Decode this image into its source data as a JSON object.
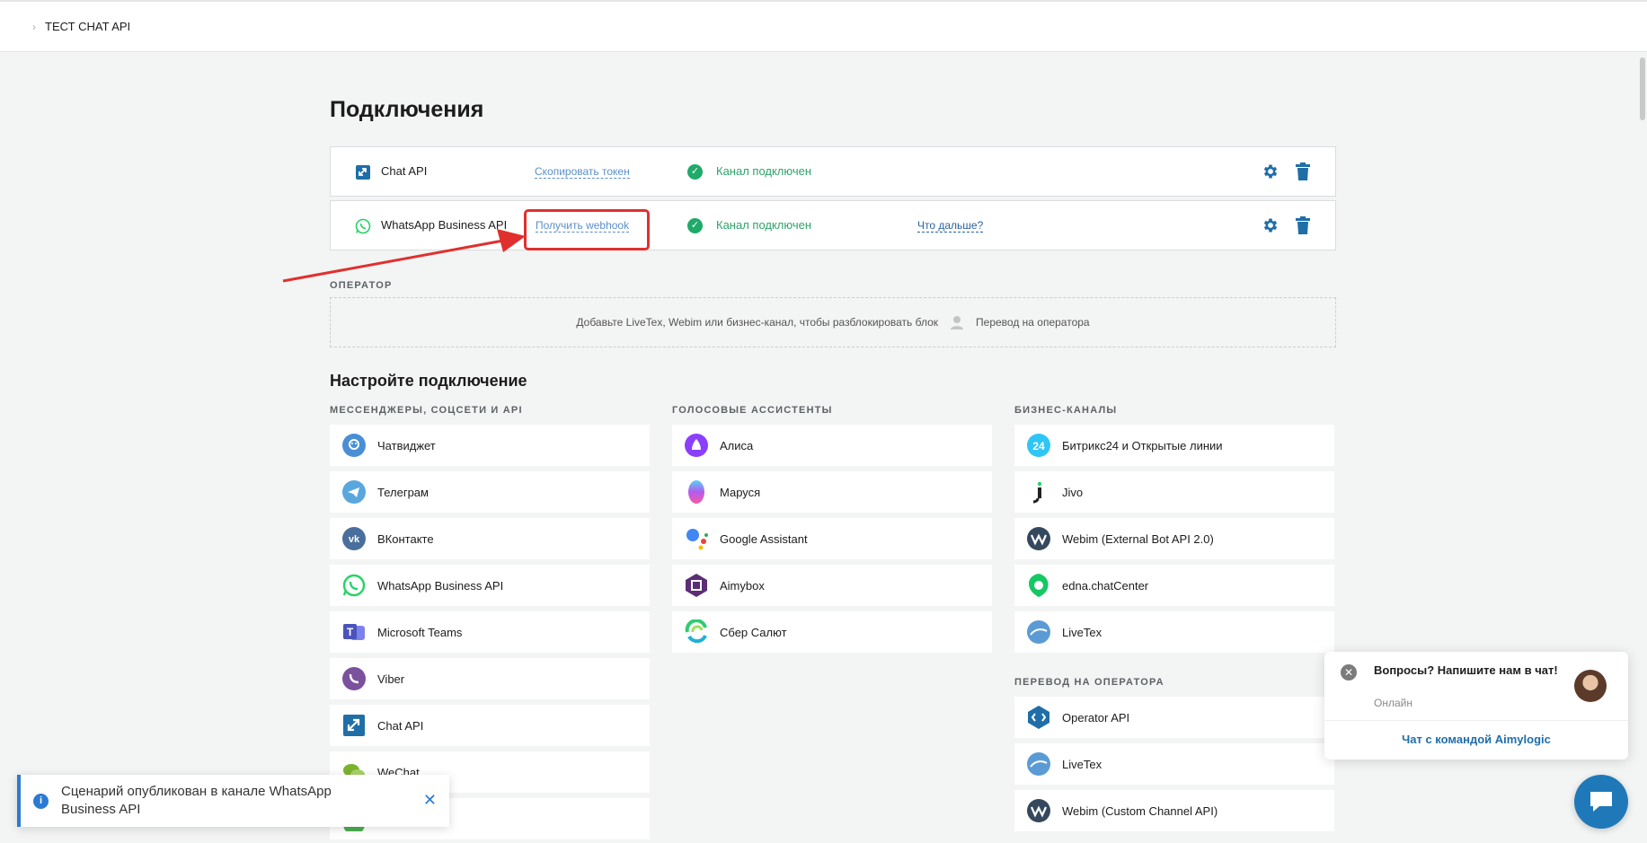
{
  "breadcrumb": {
    "item": "ТЕСТ CHAT API"
  },
  "page": {
    "title": "Подключения"
  },
  "connections": [
    {
      "name": "Chat API",
      "action": "Скопировать токен",
      "status": "Канал подключен",
      "next": ""
    },
    {
      "name": "WhatsApp Business API",
      "action": "Получить webhook",
      "status": "Канал подключен",
      "next": "Что дальше?"
    }
  ],
  "operator": {
    "label": "ОПЕРАТОР",
    "message": "Добавьте LiveTex, Webim или бизнес-канал, чтобы разблокировать блок",
    "action": "Перевод на оператора"
  },
  "setup": {
    "title": "Настройте подключение",
    "messengers": {
      "label": "МЕССЕНДЖЕРЫ, СОЦСЕТИ И API",
      "items": [
        "Чатвиджет",
        "Телеграм",
        "ВКонтакте",
        "WhatsApp Business API",
        "Microsoft Teams",
        "Viber",
        "Chat API",
        "WeChat",
        ""
      ]
    },
    "voice": {
      "label": "ГОЛОСОВЫЕ АССИСТЕНТЫ",
      "items": [
        "Алиса",
        "Маруся",
        "Google Assistant",
        "Aimybox",
        "Сбер Салют"
      ]
    },
    "business": {
      "label": "БИЗНЕС-КАНАЛЫ",
      "items": [
        "Битрикс24 и Открытые линии",
        "Jivo",
        "Webim (External Bot API 2.0)",
        "edna.chatCenter",
        "LiveTex"
      ]
    },
    "operator_transfer": {
      "label": "ПЕРЕВОД НА ОПЕРАТОРА",
      "items": [
        "Operator API",
        "LiveTex",
        "Webim (Custom Channel API)"
      ]
    }
  },
  "toast": {
    "message": "Сценарий опубликован в канале WhatsApp Business API"
  },
  "chat_widget": {
    "question": "Вопросы? Напишите нам в чат!",
    "status": "Онлайн",
    "team_link": "Чат с командой Aimylogic"
  },
  "colors": {
    "accent": "#1f79b8",
    "success": "#1faa6a",
    "highlight": "#e0302e"
  }
}
